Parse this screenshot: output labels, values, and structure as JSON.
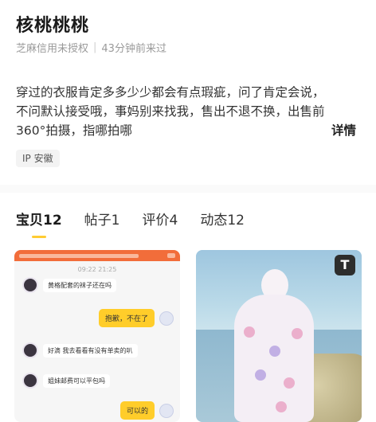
{
  "profile": {
    "name": "核桃桃桃",
    "credit": "芝麻信用未授权",
    "last_seen": "43分钟前来过",
    "bio": "穿过的衣服肯定多多少少都会有点瑕疵，问了肯定会说，不问默认接受哦，事妈别来找我，售出不退不换，出售前360°拍摄，指哪拍哪",
    "detail_label": "详情",
    "ip_label": "IP 安徽"
  },
  "tabs": [
    {
      "label": "宝贝",
      "count": "12"
    },
    {
      "label": "帖子",
      "count": "1"
    },
    {
      "label": "评价",
      "count": "4"
    },
    {
      "label": "动态",
      "count": "12"
    }
  ],
  "items": {
    "left": {
      "type": "chat-screenshot",
      "time": "09:22 21:25",
      "messages": [
        {
          "side": "in",
          "text": "黄格配套的袜子还在吗"
        },
        {
          "side": "out",
          "text": "抱歉，不在了"
        },
        {
          "side": "in",
          "text": "好滴 我去看看有没有单卖的叭"
        },
        {
          "side": "in",
          "text": "姐妹邮费可以平包吗"
        },
        {
          "side": "out",
          "text": "可以的"
        }
      ]
    },
    "right": {
      "type": "photo",
      "badge": "T"
    }
  },
  "colors": {
    "accent": "#ffcc33",
    "chat_header": "#f26d3a",
    "bubble_out": "#ffcd2a"
  }
}
